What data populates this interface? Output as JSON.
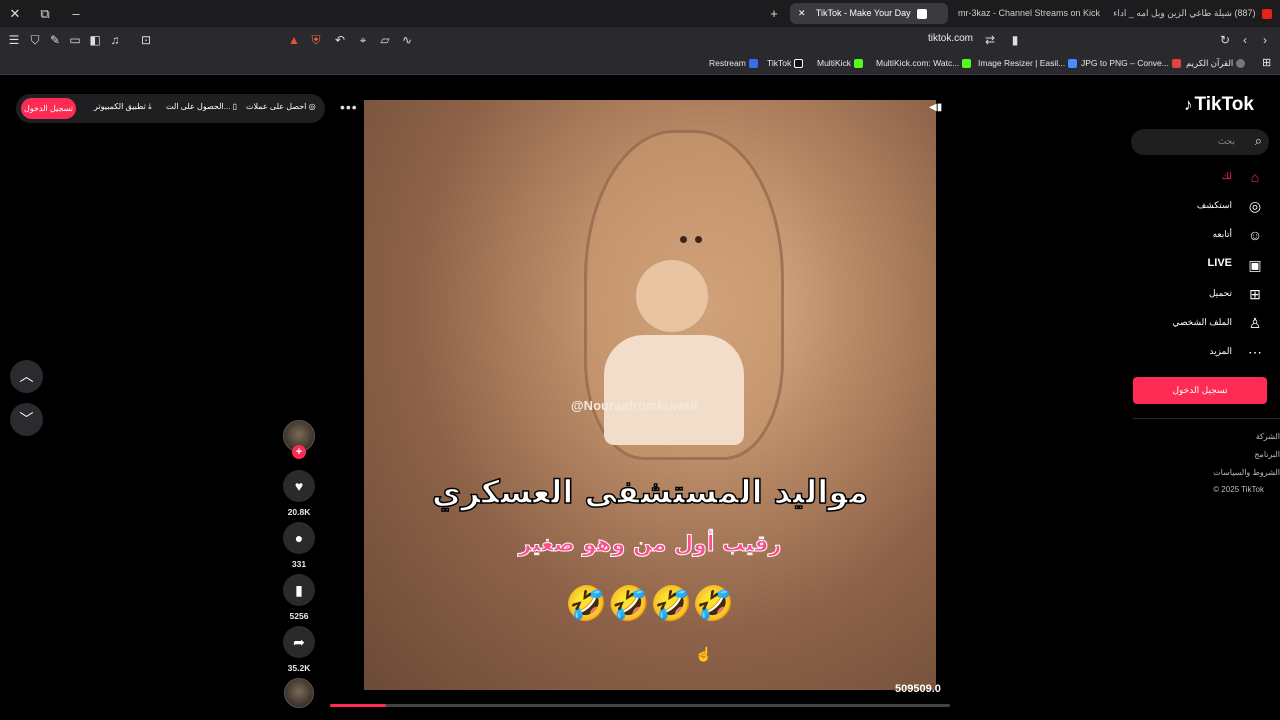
{
  "browser": {
    "tabs": [
      {
        "label": "(887) شيلة طاغي الزين ويل امه _ اداء",
        "favicon_color": "#e62117",
        "active": false
      },
      {
        "label": "mr-3kaz - Channel Streams on Kick",
        "favicon_color": "#53fc18",
        "active": false
      },
      {
        "label": "TikTok - Make Your Day",
        "favicon_color": "#ffffff",
        "active": true
      }
    ],
    "url": "tiktok.com",
    "bookmarks": [
      {
        "label": "Restream",
        "color": "#3a6df0"
      },
      {
        "label": "TikTok",
        "color": "#111111"
      },
      {
        "label": "MultiKick",
        "color": "#53fc18"
      },
      {
        "label": "MultiKick.com: Watc...",
        "color": "#53fc18"
      },
      {
        "label": "Image Resizer | Easil...",
        "color": "#4a8cff"
      },
      {
        "label": "JPG to PNG – Conve...",
        "color": "#e0443c"
      },
      {
        "label": "القرآن الكريم",
        "color": "#777777"
      }
    ]
  },
  "top_actions": {
    "login": "تسجيل الدخول",
    "desktop_app": "تطبيق الكمبيوتر",
    "get_app": "الحصول على الت...",
    "get_coins": "احصل على عملات"
  },
  "video": {
    "watermark": "@Nouraafromkuwait",
    "caption_main": "مواليد المستشفى العسكري",
    "caption_sub": "رقيب أول من وهو صغير",
    "emojis": "🤣🤣🤣🤣",
    "view_count": "509509.0",
    "progress_percent": 9
  },
  "rail": {
    "likes": "20.8K",
    "comments": "331",
    "saves": "5256",
    "shares": "35.2K"
  },
  "sidebar": {
    "logo": "TikTok",
    "search_placeholder": "بحث",
    "items": [
      {
        "label": "لك",
        "icon": "home-icon",
        "active": true
      },
      {
        "label": "استكشف",
        "icon": "compass-icon",
        "active": false
      },
      {
        "label": "أتابعه",
        "icon": "user-follow-icon",
        "active": false
      },
      {
        "label": "LIVE",
        "icon": "live-tv-icon",
        "active": false
      },
      {
        "label": "تحميل",
        "icon": "upload-icon",
        "active": false
      },
      {
        "label": "الملف الشخصي",
        "icon": "profile-icon",
        "active": false
      },
      {
        "label": "المزيد",
        "icon": "more-icon",
        "active": false
      }
    ],
    "login_button": "تسجيل الدخول",
    "footer": [
      "الشركة",
      "البرنامج",
      "الشروط والسياسات",
      "© 2025 TikTok"
    ]
  },
  "colors": {
    "accent": "#fe2c55",
    "background": "#000000"
  }
}
